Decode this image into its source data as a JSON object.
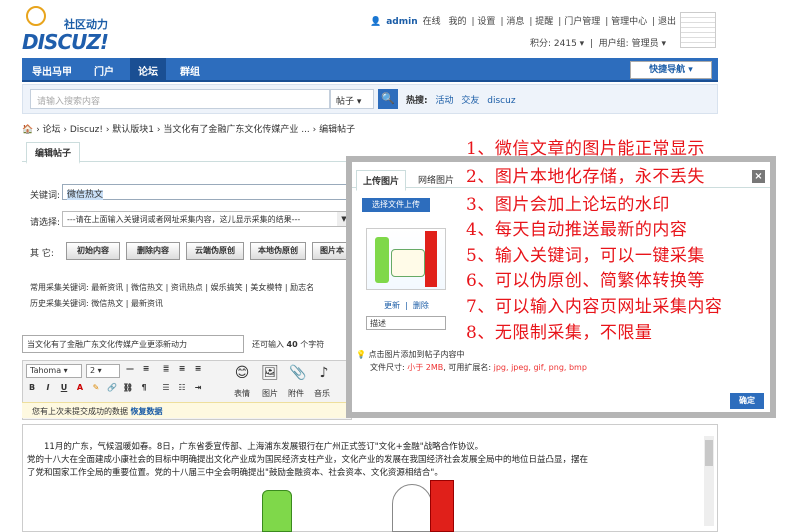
{
  "logo": {
    "brand_cn": "社区动力",
    "brand_en": "DISCUZ!"
  },
  "topbar": {
    "user": "admin",
    "status": "在线",
    "items": [
      "我的",
      "设置",
      "消息",
      "提醒",
      "门户管理",
      "管理中心",
      "退出"
    ],
    "points": "积分: 2415",
    "usergroup": "用户组: 管理员"
  },
  "nav": {
    "items": [
      "导出马甲",
      "门户",
      "论坛",
      "群组"
    ],
    "quick": "快捷导航"
  },
  "search": {
    "placeholder": "请输入搜索内容",
    "scope": "帖子",
    "hot_label": "热搜:",
    "hot": [
      "活动",
      "交友",
      "discuz"
    ]
  },
  "breadcrumb": "› 论坛 › Discuz! › 默认版块1 › 当文化有了金融广东文化传媒产业 ... › 编辑帖子",
  "tab": "编辑帖子",
  "form": {
    "keyword_label": "关键词:",
    "keyword_value": "微信热文",
    "select_label": "请选择:",
    "select_value": "---请在上面输入关键词或者网址采集内容，这儿显示采集的结果---",
    "other_label": "其  它:",
    "buttons": [
      "初始内容",
      "删除内容",
      "云端伪原创",
      "本地伪原创",
      "图片本"
    ],
    "common_label": "常用采集关键词:",
    "common_links": "最新资讯 | 微信热文 | 资讯热点 | 娱乐搞笑 | 美女模特 | 励志名",
    "history_label": "历史采集关键词:",
    "history_links": "微信热文 | 最新资讯"
  },
  "title_input": "当文化有了金融广东文化传媒产业更添新动力",
  "count_prefix": "还可输入",
  "count_value": "40",
  "count_suffix": "个字符",
  "editor": {
    "font": "Tahoma",
    "size": "2",
    "tools": [
      "表情",
      "图片",
      "附件",
      "音乐"
    ],
    "restore_text": "您有上次未提交成功的数据",
    "restore_link": "恢复数据"
  },
  "content": {
    "p1": "11月的广东，气候温暖如春。8日，广东省委宣传部、上海浦东发展银行在广州正式签订\"文化+金融\"战略合作协议。",
    "p2": "党的十八大在全面建成小康社会的目标中明确提出文化产业成为国民经济支柱产业，文化产业的发展在我国经济社会发展全局中的地位日益凸显，摆在",
    "p3": "了党和国家工作全局的重要位置。党的十八届三中全会明确提出\"鼓励金融资本、社会资本、文化资源相结合\"。"
  },
  "dialog": {
    "tab_upload": "上传图片",
    "tab_web": "网络图片",
    "upload_btn": "选择文件上传",
    "link_update": "更新",
    "link_delete": "删除",
    "desc": "描述",
    "tip": "点击图片添加到帖子内容中",
    "size_label": "文件尺寸:",
    "size_value": "小于 2MB",
    "ext_label": ", 可用扩展名:",
    "ext_value": "jpg, jpeg, gif, png, bmp",
    "ok": "确定"
  },
  "features": [
    "1、微信文章的图片能正常显示",
    "2、图片本地化存储，永不丢失",
    "3、图片会加上论坛的水印",
    "4、每天自动推送最新的内容",
    "5、输入关键词，可以一键采集",
    "6、可以伪原创、简繁体转换等",
    "7、可以输入内容页网址采集内容",
    "8、无限制采集，不限量"
  ]
}
